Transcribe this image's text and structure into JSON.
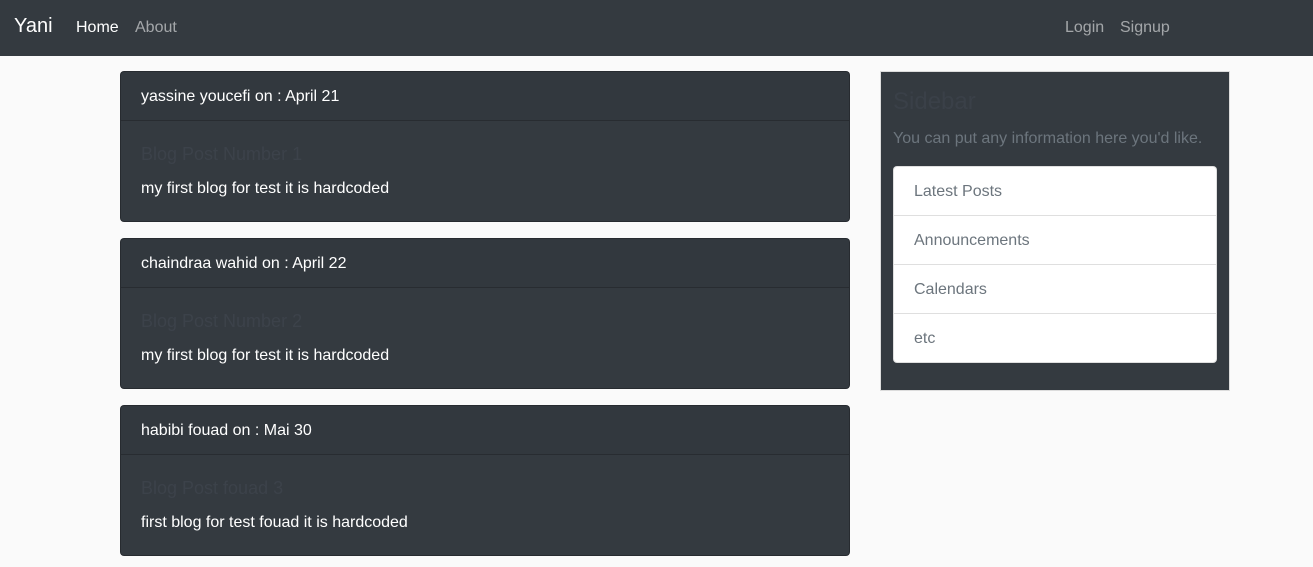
{
  "navbar": {
    "brand": "Yani",
    "links": [
      {
        "label": "Home",
        "active": true
      },
      {
        "label": "About",
        "active": false
      }
    ],
    "auth": [
      {
        "label": "Login"
      },
      {
        "label": "Signup"
      }
    ]
  },
  "posts": [
    {
      "header": "yassine youcefi on : April 21",
      "title": "Blog Post Number 1",
      "body": "my first blog for test it is hardcoded"
    },
    {
      "header": "chaindraa wahid on : April 22",
      "title": "Blog Post Number 2",
      "body": "my first blog for test it is hardcoded"
    },
    {
      "header": "habibi fouad on : Mai 30",
      "title": "Blog Post fouad 3",
      "body": "first blog for test fouad it is hardcoded"
    }
  ],
  "sidebar": {
    "title": "Sidebar",
    "lead": "You can put any information here you'd like.",
    "items": [
      {
        "label": "Latest Posts"
      },
      {
        "label": "Announcements"
      },
      {
        "label": "Calendars"
      },
      {
        "label": "etc"
      }
    ]
  },
  "colors": {
    "navbar_bg": "#343a40",
    "page_bg": "#fafafa",
    "card_bg": "#343a40"
  }
}
